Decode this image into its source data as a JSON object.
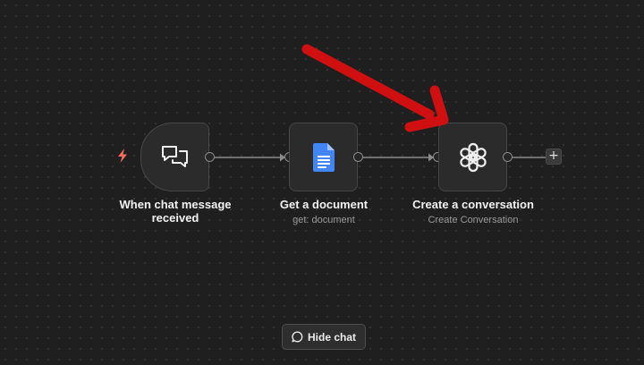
{
  "workflow": {
    "nodes": [
      {
        "title": "When chat message received",
        "title_line1": "When chat message",
        "title_line2": "received",
        "subtitle": "",
        "icon": "chat-bubbles-icon"
      },
      {
        "title": "Get a document",
        "subtitle": "get: document",
        "icon": "google-docs-icon"
      },
      {
        "title": "Create a conversation",
        "subtitle": "Create Conversation",
        "icon": "openai-icon"
      }
    ],
    "add_button_label": "+",
    "trigger_icon": "lightning-bolt-icon",
    "annotation_icon": "red-arrow"
  },
  "footer": {
    "hide_chat_label": "Hide chat",
    "hide_chat_icon": "chat-bubble-icon"
  },
  "colors": {
    "canvas_bg": "#1f1f1f",
    "node_bg": "#2b2b2b",
    "accent_arrow": "#d01010",
    "bolt": "#ff6d5a",
    "docs_blue": "#4285f4"
  }
}
